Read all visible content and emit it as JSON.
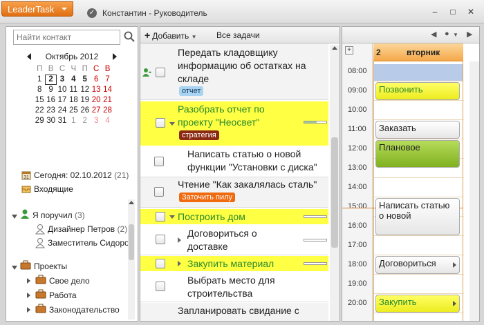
{
  "app": {
    "menu_label": "LeaderTask",
    "window_title": "Константин - Руководитель",
    "win_ctrls": [
      "–",
      "□",
      "✕"
    ]
  },
  "sidebar": {
    "search_placeholder": "Найти контакт",
    "calendar": {
      "month": "Октябрь 2012",
      "weekdays": [
        "П",
        "В",
        "С",
        "Ч",
        "П",
        "С",
        "В"
      ],
      "weeks": [
        [
          "",
          "",
          "",
          "",
          "",
          "",
          ""
        ],
        [
          "1",
          "2",
          "3",
          "4",
          "5",
          "6",
          "7"
        ],
        [
          "8",
          "9",
          "10",
          "11",
          "12",
          "13",
          "14"
        ],
        [
          "15",
          "16",
          "17",
          "18",
          "19",
          "20",
          "21"
        ],
        [
          "22",
          "23",
          "24",
          "25",
          "26",
          "27",
          "28"
        ],
        [
          "29",
          "30",
          "31",
          "1",
          "2",
          "3",
          "4"
        ]
      ],
      "today": "2"
    },
    "today_label": "Сегодня: 02.10.2012",
    "today_count": "(21)",
    "inbox_label": "Входящие",
    "assigned_label": "Я поручил",
    "assigned_count": "(3)",
    "people": [
      {
        "name": "Дизайнер Петров",
        "count": "(2)"
      },
      {
        "name": "Заместитель Сидоров",
        "count": ""
      }
    ],
    "projects_label": "Проекты",
    "projects": [
      "Свое дело",
      "Работа",
      "Законодательство"
    ]
  },
  "tasks_panel": {
    "add_label": "Добавить",
    "filter_label": "Все задачи",
    "tasks": [
      {
        "title_lines": [
          "Передать кладовщику",
          "информацию об остатках на",
          "складе"
        ],
        "tag": "отчет"
      },
      {
        "title_lines": [
          "Разобрать отчет по",
          "проекту \"Неосвет\""
        ],
        "tag": "стратегия"
      },
      {
        "title_lines": [
          "Написать статью о новой",
          "функции \"Установки с диска\""
        ],
        "tag": ""
      },
      {
        "title_lines": [
          "Чтение \"Как закалялась сталь\""
        ],
        "tag": "Заточить пилу"
      },
      {
        "title_lines": [
          "Построить дом"
        ],
        "tag": ""
      },
      {
        "title_lines": [
          "Договориться о",
          "доставке"
        ],
        "tag": ""
      },
      {
        "title_lines": [
          "Закупить материал"
        ],
        "tag": ""
      },
      {
        "title_lines": [
          "Выбрать место для",
          "строительства"
        ],
        "tag": ""
      },
      {
        "title_lines": [
          "Запланировать свидание с"
        ],
        "tag": ""
      }
    ],
    "colors": {
      "highlight": "#ffff44",
      "green_text": "#2a8a2a",
      "tag_blue": "#a8d4f2",
      "tag_brown": "#8b2a12",
      "tag_orange": "#f06a10"
    }
  },
  "day_panel": {
    "day_number": "2",
    "weekday": "вторник",
    "hours": [
      "08:00",
      "09:00",
      "10:00",
      "11:00",
      "12:00",
      "13:00",
      "14:00",
      "15:00",
      "16:00",
      "17:00",
      "18:00",
      "19:00",
      "20:00"
    ],
    "events": [
      {
        "label": "Позвонить",
        "color": "#ffff44"
      },
      {
        "label": "Заказать",
        "color": "#f2f2f2"
      },
      {
        "label": "Плановое",
        "color": "#8fbf2a"
      },
      {
        "label_lines": [
          "Написать статью",
          "о новой"
        ],
        "color": "#f2f2f2"
      },
      {
        "label": "Договориться",
        "color": "#f2f2f2"
      },
      {
        "label": "Закупить",
        "color": "#ffff44"
      }
    ]
  }
}
